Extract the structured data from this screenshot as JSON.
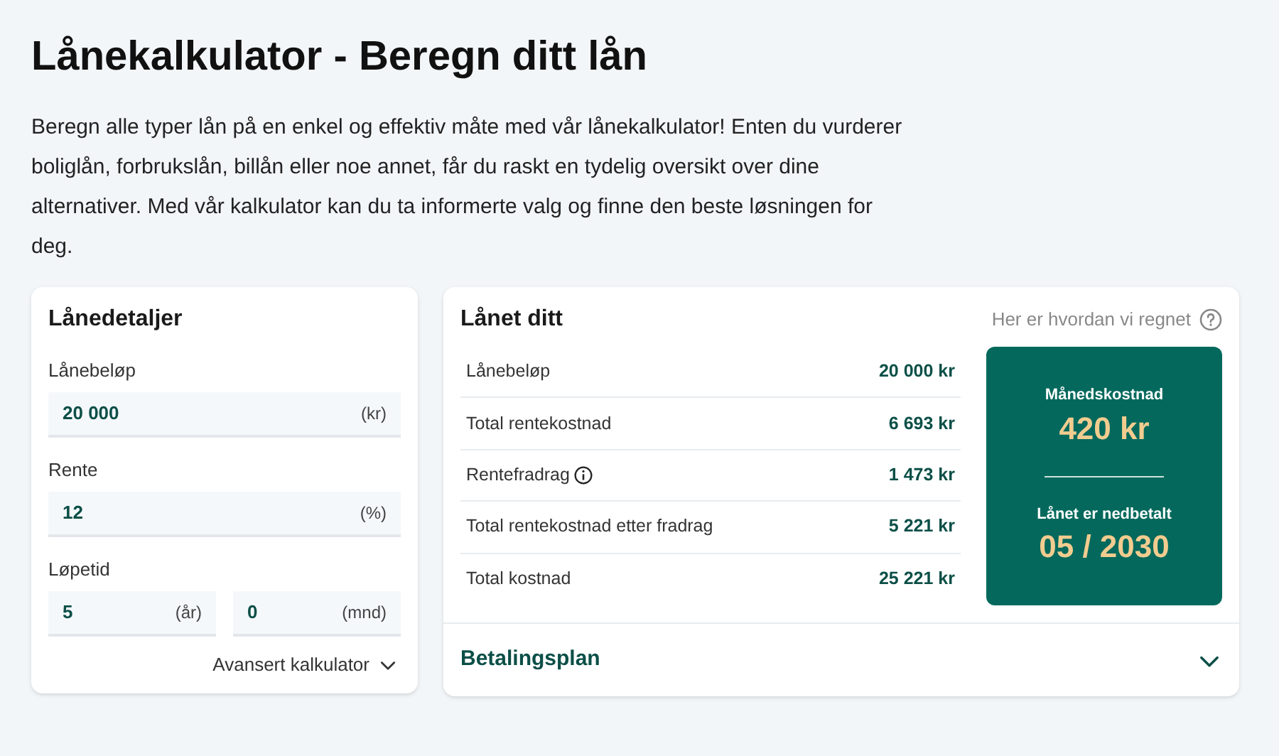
{
  "title": "Lånekalkulator - Beregn ditt lån",
  "intro": "Beregn alle typer lån på en enkel og effektiv måte med vår lånekalkulator! Enten du vurderer boliglån, forbrukslån, billån eller noe annet, får du raskt en tydelig oversikt over dine alternativer. Med vår kalkulator kan du ta informerte valg og finne den beste løsningen for deg.",
  "details": {
    "heading": "Lånedetaljer",
    "fields": [
      {
        "label": "Lånebeløp",
        "inputs": [
          {
            "value": "20 000",
            "unit": "(kr)"
          }
        ]
      },
      {
        "label": "Rente",
        "inputs": [
          {
            "value": "12",
            "unit": "(%)"
          }
        ]
      },
      {
        "label": "Løpetid",
        "inputs": [
          {
            "value": "5",
            "unit": "(år)"
          },
          {
            "value": "0",
            "unit": "(mnd)"
          }
        ]
      }
    ],
    "advanced": {
      "label": "Avansert kalkulator",
      "expanded": false
    }
  },
  "result": {
    "heading": "Lånet ditt",
    "help_link": "Her er hvordan vi regnet",
    "rows": [
      {
        "label": "Lånebeløp",
        "value": "20 000 kr",
        "info": false
      },
      {
        "label": "Total rentekostnad",
        "value": "6 693 kr",
        "info": false
      },
      {
        "label": "Rentefradrag",
        "value": "1 473 kr",
        "info": true
      },
      {
        "label": "Total rentekostnad etter fradrag",
        "value": "5 221 kr",
        "info": false
      },
      {
        "label": "Total kostnad",
        "value": "25 221 kr",
        "info": false
      }
    ],
    "summary": {
      "monthly_label": "Månedskostnad",
      "monthly_value": "420 kr",
      "paid_label": "Lånet er nedbetalt",
      "paid_value": "05 / 2030"
    },
    "payment_plan": {
      "label": "Betalingsplan",
      "expanded": false
    }
  }
}
